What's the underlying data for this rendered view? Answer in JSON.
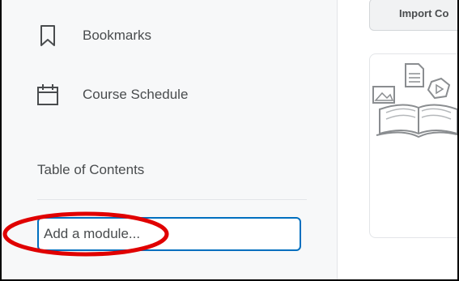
{
  "sidebar": {
    "items": [
      {
        "label": "Bookmarks",
        "icon": "bookmark-icon"
      },
      {
        "label": "Course Schedule",
        "icon": "calendar-icon"
      }
    ],
    "toc_heading": "Table of Contents",
    "module_input": {
      "value": "",
      "placeholder": "Add a module..."
    }
  },
  "main": {
    "import_button_label": "Import Co"
  },
  "colors": {
    "focus_border": "#006fbf",
    "annotation": "#e00000",
    "sidebar_bg": "#f7f8f9"
  }
}
